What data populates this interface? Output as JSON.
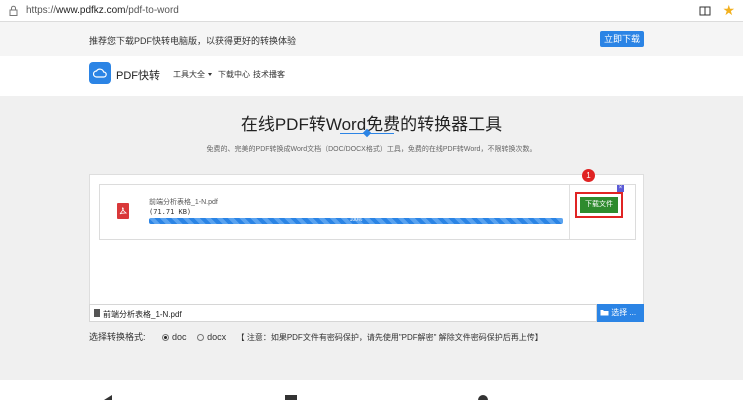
{
  "browser": {
    "url_prefix": "https://",
    "url_domain": "www.pdfkz.com",
    "url_path": "/pdf-to-word",
    "lock_icon": "lock-icon",
    "reader_icon": "reader-view-icon",
    "star_icon": "bookmark-star-icon",
    "star_color": "#f2b01e"
  },
  "promo": {
    "text": "推荐您下载PDF快转电脑版，以获得更好的转换体验",
    "button_label": "立即下载"
  },
  "nav": {
    "logo_text": "PDF快转",
    "links": [
      "工具大全",
      "下载中心",
      "技术播客"
    ]
  },
  "main": {
    "title": "在线PDF转Word免费的转换器工具",
    "subtitle": "免费的、完美的PDF转换成Word文档（DOC/DOCX格式）工具，免费的在线PDF转Word，不限转换次数。",
    "file": {
      "name": "前端分析表格_1-N.pdf",
      "size": "(71.71 KB)",
      "progress": 100,
      "progress_label": "100%",
      "download_label": "下载文件",
      "badge": "1",
      "close_label": "×"
    },
    "input": {
      "filename": "前端分析表格_1-N.pdf",
      "choose_label": "选择 ..."
    },
    "format": {
      "label": "选择转换格式:",
      "options": [
        "doc",
        "docx"
      ],
      "selected": "doc",
      "note": "【 注意：如果PDF文件有密码保护，请先使用\"PDF解密\" 解除文件密码保护后再上传】"
    }
  },
  "colors": {
    "accent": "#2b84e5",
    "download_green": "#2e8b2e",
    "highlight_red": "#e02424",
    "pdf_red": "#d9383a"
  }
}
